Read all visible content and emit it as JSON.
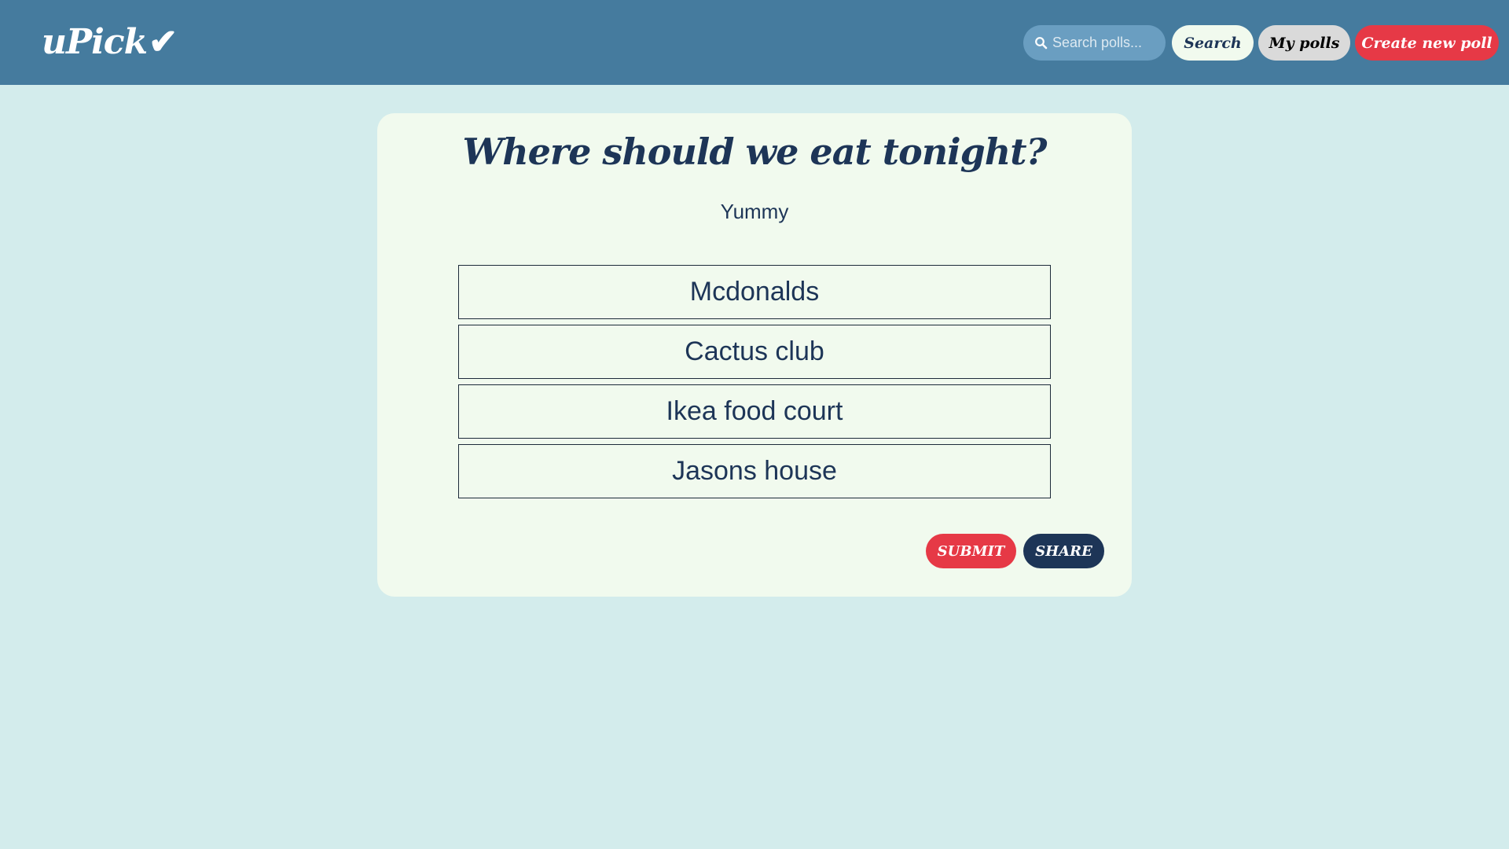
{
  "header": {
    "logo": "uPick",
    "logo_check": "✔",
    "search_placeholder": "Search polls...",
    "search_label": "Search",
    "my_polls_label": "My polls",
    "create_label": "Create new poll"
  },
  "poll": {
    "title": "Where should we eat tonight?",
    "description": "Yummy",
    "options": [
      "Mcdonalds",
      "Cactus club",
      "Ikea food court",
      "Jasons house"
    ],
    "submit_label": "SUBMIT",
    "share_label": "SHARE"
  },
  "colors": {
    "navbar": "#457b9e",
    "background": "#d3ecec",
    "card": "#f1faee",
    "accent_red": "#e63946",
    "navy": "#1d3557"
  }
}
